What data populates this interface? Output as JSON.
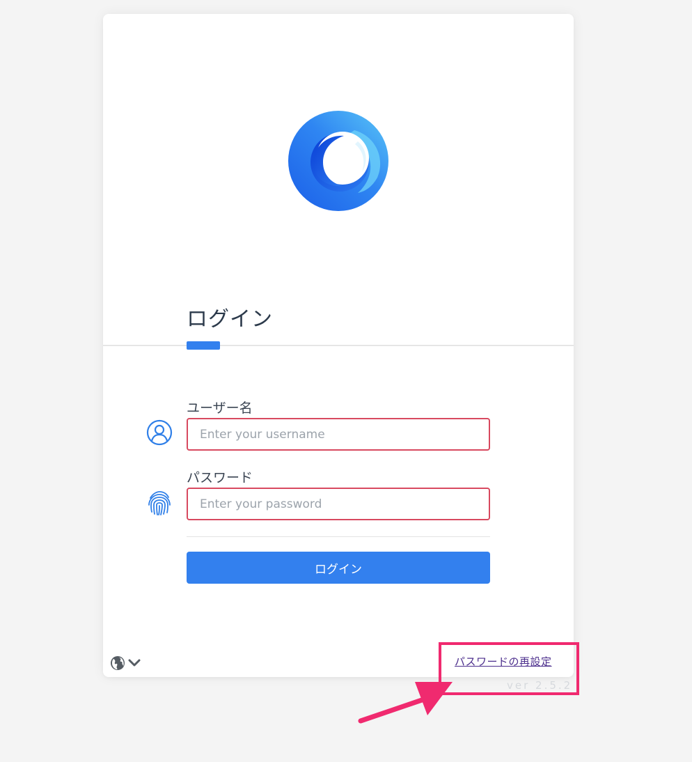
{
  "login": {
    "title": "ログイン",
    "username_label": "ユーザー名",
    "username_placeholder": "Enter your username",
    "username_value": "",
    "password_label": "パスワード",
    "password_placeholder": "Enter your password",
    "password_value": "",
    "submit_label": "ログイン"
  },
  "footer": {
    "reset_password_link": "パスワードの再設定",
    "version": "ver 2.5.2",
    "language_icon": "globe-icon",
    "language_dropdown_icon": "chevron-down-icon"
  },
  "icons": {
    "logo": "swirl-logo",
    "username": "user-circle-icon",
    "password": "fingerprint-icon"
  },
  "colors": {
    "accent": "#3380ee",
    "input_error_border": "#d8495f",
    "annotation": "#f02a6f",
    "link": "#4b2d8c"
  }
}
